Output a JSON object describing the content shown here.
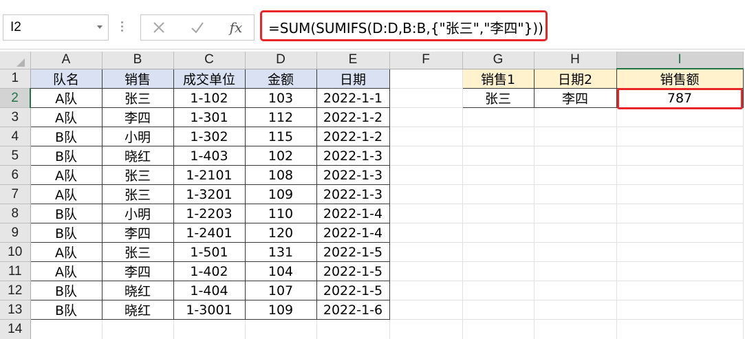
{
  "name_box": {
    "value": "I2"
  },
  "formula_bar": {
    "cancel_glyph": "✕",
    "enter_glyph": "✓",
    "fx_label": "fx",
    "formula": "=SUM(SUMIFS(D:D,B:B,{\"张三\",\"李四\"}))"
  },
  "columns": [
    "A",
    "B",
    "C",
    "D",
    "E",
    "F",
    "G",
    "H",
    "I"
  ],
  "rows": [
    {
      "num": "1",
      "cells": [
        "队名",
        "销售",
        "成交单位",
        "金额",
        "日期",
        "",
        "销售1",
        "日期2",
        "销售额"
      ]
    },
    {
      "num": "2",
      "cells": [
        "A队",
        "张三",
        "1-102",
        "103",
        "2022-1-1",
        "",
        "张三",
        "李四",
        "787"
      ]
    },
    {
      "num": "3",
      "cells": [
        "A队",
        "李四",
        "1-301",
        "112",
        "2022-1-2",
        "",
        "",
        "",
        ""
      ]
    },
    {
      "num": "4",
      "cells": [
        "B队",
        "小明",
        "1-302",
        "115",
        "2022-1-2",
        "",
        "",
        "",
        ""
      ]
    },
    {
      "num": "5",
      "cells": [
        "B队",
        "晓红",
        "1-403",
        "102",
        "2022-1-3",
        "",
        "",
        "",
        ""
      ]
    },
    {
      "num": "6",
      "cells": [
        "A队",
        "张三",
        "1-2101",
        "108",
        "2022-1-3",
        "",
        "",
        "",
        ""
      ]
    },
    {
      "num": "7",
      "cells": [
        "A队",
        "张三",
        "1-3201",
        "109",
        "2022-1-3",
        "",
        "",
        "",
        ""
      ]
    },
    {
      "num": "8",
      "cells": [
        "B队",
        "小明",
        "1-2203",
        "110",
        "2022-1-4",
        "",
        "",
        "",
        ""
      ]
    },
    {
      "num": "9",
      "cells": [
        "B队",
        "李四",
        "1-2401",
        "120",
        "2022-1-4",
        "",
        "",
        "",
        ""
      ]
    },
    {
      "num": "10",
      "cells": [
        "A队",
        "张三",
        "1-501",
        "131",
        "2022-1-5",
        "",
        "",
        "",
        ""
      ]
    },
    {
      "num": "11",
      "cells": [
        "A队",
        "李四",
        "1-402",
        "104",
        "2022-1-5",
        "",
        "",
        "",
        ""
      ]
    },
    {
      "num": "12",
      "cells": [
        "B队",
        "晓红",
        "1-404",
        "107",
        "2022-1-5",
        "",
        "",
        "",
        ""
      ]
    },
    {
      "num": "13",
      "cells": [
        "B队",
        "晓红",
        "1-3001",
        "109",
        "2022-1-6",
        "",
        "",
        "",
        ""
      ]
    }
  ],
  "partial_row": {
    "num": "14"
  },
  "colors": {
    "highlight_red": "#e8262a",
    "header_blue": "#d9e1f2",
    "header_yellow": "#fff2cc",
    "excel_green": "#217346"
  }
}
